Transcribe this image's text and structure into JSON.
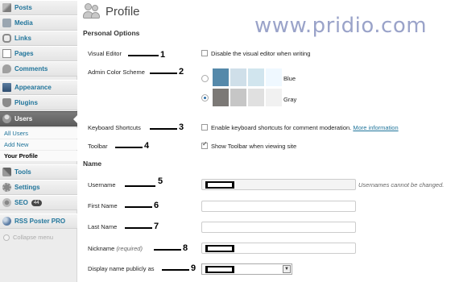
{
  "sidebar": {
    "items": [
      {
        "label": "Posts",
        "icon": "posts-icon"
      },
      {
        "label": "Media",
        "icon": "media-icon"
      },
      {
        "label": "Links",
        "icon": "links-icon"
      },
      {
        "label": "Pages",
        "icon": "pages-icon"
      },
      {
        "label": "Comments",
        "icon": "comments-icon"
      },
      {
        "label": "Appearance",
        "icon": "appearance-icon"
      },
      {
        "label": "Plugins",
        "icon": "plugins-icon"
      },
      {
        "label": "Users",
        "icon": "users-icon",
        "active": true
      },
      {
        "label": "Tools",
        "icon": "tools-icon"
      },
      {
        "label": "Settings",
        "icon": "settings-icon"
      },
      {
        "label": "SEO",
        "icon": "seo-icon",
        "badge": "44"
      },
      {
        "label": "RSS Poster PRO",
        "icon": "rss-icon"
      }
    ],
    "users_submenu": [
      "All Users",
      "Add New",
      "Your Profile"
    ],
    "current_submenu": "Your Profile",
    "collapse_label": "Collapse menu"
  },
  "header": {
    "title": "Profile",
    "watermark": "www.pridio.com"
  },
  "personal_options": {
    "heading": "Personal Options",
    "visual_editor": {
      "label": "Visual Editor",
      "checkbox_label": "Disable the visual editor when writing",
      "checked": false,
      "marker": "1"
    },
    "admin_color_scheme": {
      "label": "Admin Color Scheme",
      "marker": "2",
      "options": [
        {
          "name": "Blue",
          "selected": false,
          "swatches": [
            "#5589aa",
            "#cfdfe9",
            "#d1e5ee",
            "#eff8ff"
          ]
        },
        {
          "name": "Gray",
          "selected": true,
          "swatches": [
            "#7c7976",
            "#c6c6c6",
            "#e0e0e0",
            "#f1f1f1"
          ]
        }
      ]
    },
    "keyboard_shortcuts": {
      "label": "Keyboard Shortcuts",
      "checkbox_label": "Enable keyboard shortcuts for comment moderation.",
      "link": "More information",
      "checked": false,
      "marker": "3"
    },
    "toolbar": {
      "label": "Toolbar",
      "checkbox_label": "Show Toolbar when viewing site",
      "checked": true,
      "marker": "4"
    }
  },
  "name_section": {
    "heading": "Name",
    "username": {
      "label": "Username",
      "note": "Usernames cannot be changed.",
      "marker": "5"
    },
    "first_name": {
      "label": "First Name",
      "value": "",
      "marker": "6"
    },
    "last_name": {
      "label": "Last Name",
      "value": "",
      "marker": "7"
    },
    "nickname": {
      "label": "Nickname",
      "required": "(required)",
      "marker": "8"
    },
    "display_name": {
      "label": "Display name publicly as",
      "marker": "9"
    }
  },
  "colors": {
    "link": "#21759b",
    "sidebar_active": "#5d5d5d",
    "watermark": "#9aa3c9"
  }
}
